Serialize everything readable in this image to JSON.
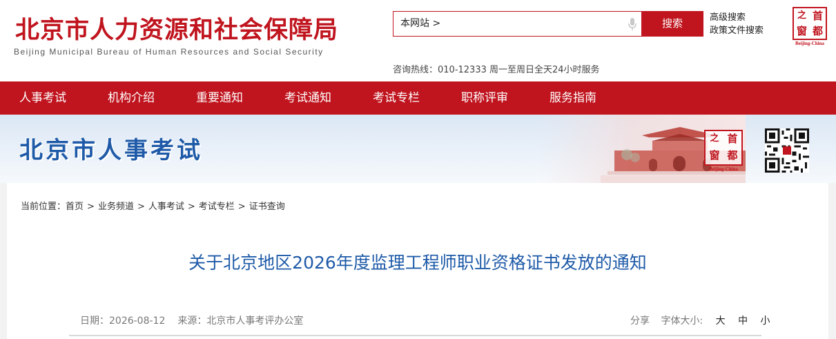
{
  "header": {
    "title": "北京市人力资源和社会保障局",
    "subtitle": "Beijing Municipal Bureau of Human Resources and Social Security",
    "search": {
      "scope": "本网站 >",
      "button": "搜索"
    },
    "links": [
      "高级搜索",
      "政策文件搜索"
    ],
    "hotline": "咨询热线：010-12333 周一至周日全天24小时服务",
    "seal": {
      "chars": [
        "之",
        "首",
        "窗",
        "都"
      ],
      "caption": "Beijing-China"
    }
  },
  "nav": {
    "items": [
      "人事考试",
      "机构介绍",
      "重要通知",
      "考试通知",
      "考试专栏",
      "职称评审",
      "服务指南"
    ]
  },
  "banner": {
    "title": "北京市人事考试",
    "seal": {
      "chars": [
        "之",
        "首",
        "窗",
        "都"
      ],
      "caption": "Beijing-China"
    }
  },
  "breadcrumb": {
    "label": "当前位置：",
    "items": [
      "首页",
      "业务频道",
      "人事考试",
      "考试专栏",
      "证书查询"
    ],
    "separator": ">"
  },
  "article": {
    "title": "关于北京地区2026年度监理工程师职业资格证书发放的通知",
    "date": "日期：2026-08-12",
    "source": "来源：北京市人事考评办公室",
    "share": "分享",
    "font_size_label": "字体大小:",
    "font_sizes": [
      "大",
      "中",
      "小"
    ]
  },
  "colors": {
    "brand_red": "#c0141e",
    "title_blue": "#1e5aa8"
  }
}
